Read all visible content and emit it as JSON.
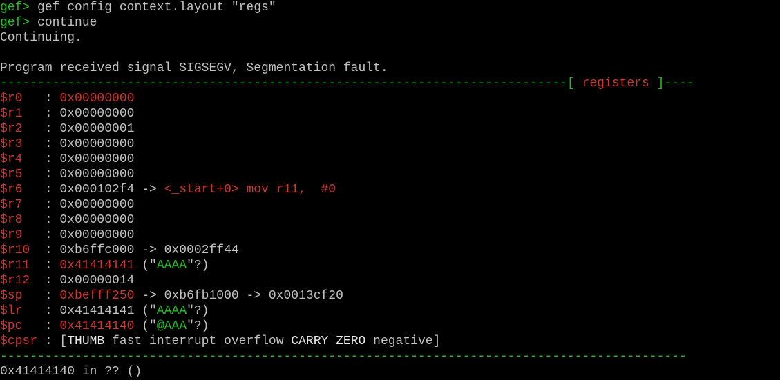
{
  "session": {
    "lines": [
      {
        "prompt": "gef>",
        "command": " gef config context.layout \"regs\""
      },
      {
        "prompt": "gef>",
        "command": " continue"
      }
    ],
    "continuing": "Continuing.",
    "blank": "",
    "signal_msg": "Program received signal SIGSEGV, Segmentation fault."
  },
  "separator": {
    "left_dashes": "----------------------------------------------------------------------------",
    "open_bracket": "[ ",
    "title": "registers",
    "close_bracket": " ]",
    "right_dashes": "----",
    "bottom_dashes": "--------------------------------------------------------------------------------------------"
  },
  "registers": [
    {
      "name": "$r0   ",
      "colon": ": ",
      "value": "0x00000000",
      "value_changed": true,
      "extra": []
    },
    {
      "name": "$r1   ",
      "colon": ": ",
      "value": "0x00000000",
      "value_changed": false,
      "extra": []
    },
    {
      "name": "$r2   ",
      "colon": ": ",
      "value": "0x00000001",
      "value_changed": false,
      "extra": []
    },
    {
      "name": "$r3   ",
      "colon": ": ",
      "value": "0x00000000",
      "value_changed": false,
      "extra": []
    },
    {
      "name": "$r4   ",
      "colon": ": ",
      "value": "0x00000000",
      "value_changed": false,
      "extra": []
    },
    {
      "name": "$r5   ",
      "colon": ": ",
      "value": "0x00000000",
      "value_changed": false,
      "extra": []
    },
    {
      "name": "$r6   ",
      "colon": ": ",
      "value": "0x000102f4",
      "value_changed": false,
      "extra": [
        {
          "text": " -> ",
          "color": "gray"
        },
        {
          "text": "<_start+0> mov r11,  #0",
          "color": "red"
        }
      ]
    },
    {
      "name": "$r7   ",
      "colon": ": ",
      "value": "0x00000000",
      "value_changed": false,
      "extra": []
    },
    {
      "name": "$r8   ",
      "colon": ": ",
      "value": "0x00000000",
      "value_changed": false,
      "extra": []
    },
    {
      "name": "$r9   ",
      "colon": ": ",
      "value": "0x00000000",
      "value_changed": false,
      "extra": []
    },
    {
      "name": "$r10  ",
      "colon": ": ",
      "value": "0xb6ffc000",
      "value_changed": false,
      "extra": [
        {
          "text": " -> 0x0002ff44",
          "color": "gray"
        }
      ]
    },
    {
      "name": "$r11  ",
      "colon": ": ",
      "value": "0x41414141",
      "value_changed": true,
      "extra": [
        {
          "text": " (\"",
          "color": "gray"
        },
        {
          "text": "AAAA",
          "color": "green"
        },
        {
          "text": "\"?)",
          "color": "gray"
        }
      ]
    },
    {
      "name": "$r12  ",
      "colon": ": ",
      "value": "0x00000014",
      "value_changed": false,
      "extra": []
    },
    {
      "name": "$sp   ",
      "colon": ": ",
      "value": "0xbefff250",
      "value_changed": true,
      "extra": [
        {
          "text": " -> 0xb6fb1000 -> 0x0013cf20",
          "color": "gray"
        }
      ]
    },
    {
      "name": "$lr   ",
      "colon": ": ",
      "value": "0x41414141",
      "value_changed": false,
      "extra": [
        {
          "text": " (\"",
          "color": "gray"
        },
        {
          "text": "AAAA",
          "color": "green"
        },
        {
          "text": "\"?)",
          "color": "gray"
        }
      ]
    },
    {
      "name": "$pc   ",
      "colon": ": ",
      "value": "0x41414140",
      "value_changed": true,
      "extra": [
        {
          "text": " (\"",
          "color": "gray"
        },
        {
          "text": "@AAA",
          "color": "green"
        },
        {
          "text": "\"?)",
          "color": "gray"
        }
      ]
    }
  ],
  "cpsr": {
    "name": "$cpsr ",
    "colon": ": ",
    "open": "[",
    "flags": [
      {
        "text": "THUMB",
        "bright": true
      },
      {
        "text": " fast interrupt overflow ",
        "bright": false
      },
      {
        "text": "CARRY",
        "bright": true
      },
      {
        "text": " ",
        "bright": false
      },
      {
        "text": "ZERO",
        "bright": true
      },
      {
        "text": " negative",
        "bright": false
      }
    ],
    "close": "]"
  },
  "location": "0x41414140 in ?? ()",
  "colors": {
    "background": "#000000",
    "text": "#c0c0c0",
    "prompt_green": "#1fbf1f",
    "register_red": "#d0342c",
    "string_green": "#1fbf1f"
  }
}
